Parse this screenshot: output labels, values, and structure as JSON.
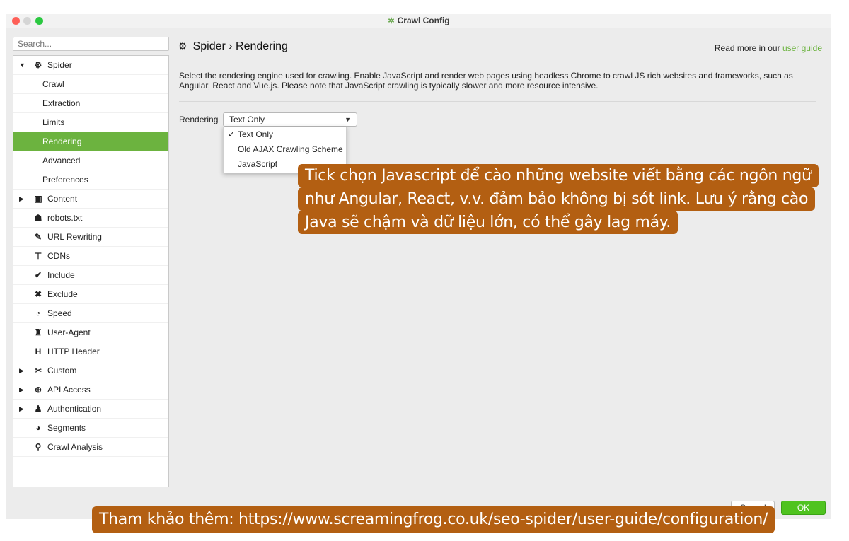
{
  "window": {
    "title": "Crawl Config",
    "colors": {
      "accent": "#6cb33f",
      "ok_button": "#4fc31f",
      "callout": "#b35f12"
    }
  },
  "sidebar": {
    "search_placeholder": "Search...",
    "items": [
      {
        "label": "Spider",
        "icon": "gear-icon",
        "glyph": "⚙",
        "expander": "▼",
        "selected": false,
        "child": false
      },
      {
        "label": "Crawl",
        "icon": "",
        "glyph": "",
        "expander": "",
        "selected": false,
        "child": true
      },
      {
        "label": "Extraction",
        "icon": "",
        "glyph": "",
        "expander": "",
        "selected": false,
        "child": true
      },
      {
        "label": "Limits",
        "icon": "",
        "glyph": "",
        "expander": "",
        "selected": false,
        "child": true
      },
      {
        "label": "Rendering",
        "icon": "",
        "glyph": "",
        "expander": "",
        "selected": true,
        "child": true
      },
      {
        "label": "Advanced",
        "icon": "",
        "glyph": "",
        "expander": "",
        "selected": false,
        "child": true
      },
      {
        "label": "Preferences",
        "icon": "",
        "glyph": "",
        "expander": "",
        "selected": false,
        "child": true
      },
      {
        "label": "Content",
        "icon": "window-icon",
        "glyph": "▣",
        "expander": "▶",
        "selected": false,
        "child": false
      },
      {
        "label": "robots.txt",
        "icon": "robot-icon",
        "glyph": "☗",
        "expander": "",
        "selected": false,
        "child": false
      },
      {
        "label": "URL Rewriting",
        "icon": "edit-icon",
        "glyph": "✎",
        "expander": "",
        "selected": false,
        "child": false
      },
      {
        "label": "CDNs",
        "icon": "sitemap-icon",
        "glyph": "⊤",
        "expander": "",
        "selected": false,
        "child": false
      },
      {
        "label": "Include",
        "icon": "check-circle-icon",
        "glyph": "✔",
        "expander": "",
        "selected": false,
        "child": false
      },
      {
        "label": "Exclude",
        "icon": "times-circle-icon",
        "glyph": "✖",
        "expander": "",
        "selected": false,
        "child": false
      },
      {
        "label": "Speed",
        "icon": "speedometer-icon",
        "glyph": "◔",
        "expander": "",
        "selected": false,
        "child": false
      },
      {
        "label": "User-Agent",
        "icon": "user-secret-icon",
        "glyph": "♜",
        "expander": "",
        "selected": false,
        "child": false
      },
      {
        "label": "HTTP Header",
        "icon": "header-icon",
        "glyph": "H",
        "expander": "",
        "selected": false,
        "child": false
      },
      {
        "label": "Custom",
        "icon": "tools-icon",
        "glyph": "✂",
        "expander": "▶",
        "selected": false,
        "child": false
      },
      {
        "label": "API Access",
        "icon": "globe-icon",
        "glyph": "⊕",
        "expander": "▶",
        "selected": false,
        "child": false
      },
      {
        "label": "Authentication",
        "icon": "users-lock-icon",
        "glyph": "♟",
        "expander": "▶",
        "selected": false,
        "child": false
      },
      {
        "label": "Segments",
        "icon": "pie-chart-icon",
        "glyph": "◕",
        "expander": "",
        "selected": false,
        "child": false
      },
      {
        "label": "Crawl Analysis",
        "icon": "search-icon",
        "glyph": "⚲",
        "expander": "",
        "selected": false,
        "child": false
      }
    ]
  },
  "main": {
    "breadcrumb_parent": "Spider",
    "breadcrumb_sep": "›",
    "breadcrumb_current": "Rendering",
    "read_more_prefix": "Read more in our",
    "read_more_link": "user guide",
    "description": "Select the rendering engine used for crawling. Enable JavaScript and render web pages using headless Chrome to crawl JS rich websites and frameworks, such as Angular, React and Vue.js. Please note that JavaScript crawling is typically slower and more resource intensive.",
    "rendering_label": "Rendering",
    "rendering_value": "Text Only",
    "rendering_options": [
      {
        "label": "Text Only",
        "checked": true
      },
      {
        "label": "Old AJAX Crawling Scheme",
        "checked": false
      },
      {
        "label": "JavaScript",
        "checked": false
      }
    ]
  },
  "footer": {
    "cancel_label": "Cancel",
    "ok_label": "OK"
  },
  "annotations": {
    "callout_lines": [
      "Tick chọn Javascript để cào những website viết bằng các ngôn ngữ",
      "như Angular, React, v.v. đảm bảo không bị sót link. Lưu ý rằng cào",
      "Java sẽ chậm và dữ liệu lớn, có thể gây lag máy."
    ],
    "bottom_banner": "Tham khảo thêm: https://www.screamingfrog.co.uk/seo-spider/user-guide/configuration/"
  }
}
